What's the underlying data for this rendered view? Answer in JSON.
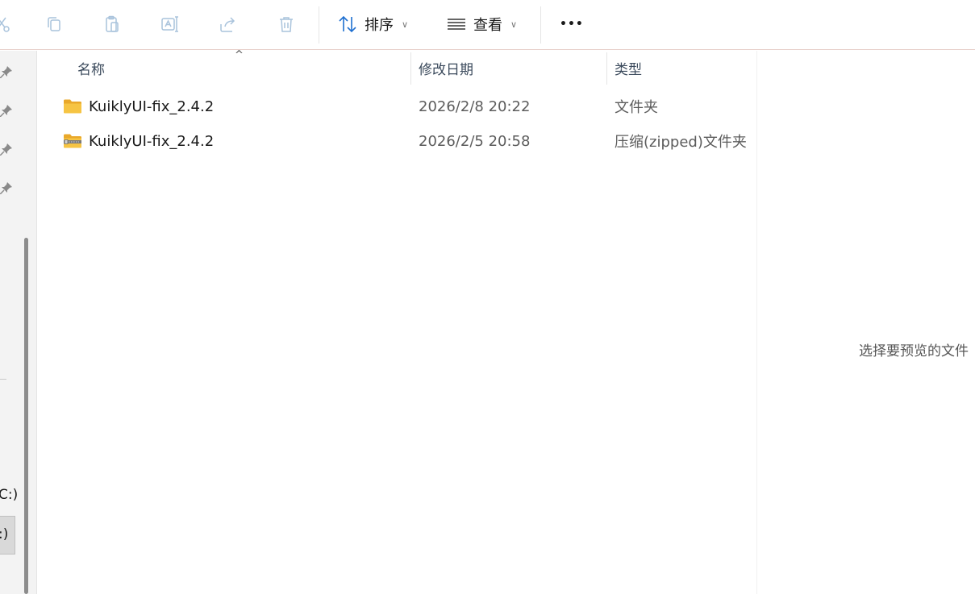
{
  "toolbar": {
    "sort_label": "排序",
    "view_label": "查看",
    "more_label": "•••"
  },
  "nav": {
    "drive_c_label": "C:)",
    "drive_selected_label": ":)"
  },
  "columns": {
    "name": "名称",
    "date": "修改日期",
    "type": "类型"
  },
  "files": [
    {
      "name": "KuiklyUI-fix_2.4.2",
      "date": "2026/2/8 20:22",
      "type": "文件夹",
      "icon": "folder-icon"
    },
    {
      "name": "KuiklyUI-fix_2.4.2",
      "date": "2026/2/5 20:58",
      "type": "压缩(zipped)文件夹",
      "icon": "zip-folder-icon"
    }
  ],
  "preview": {
    "message": "选择要预览的文件"
  },
  "colors": {
    "toolbar_icon_disabled": "#a9c3dc",
    "accent_blue": "#1e6fd0",
    "folder_yellow": "#f6c443"
  }
}
